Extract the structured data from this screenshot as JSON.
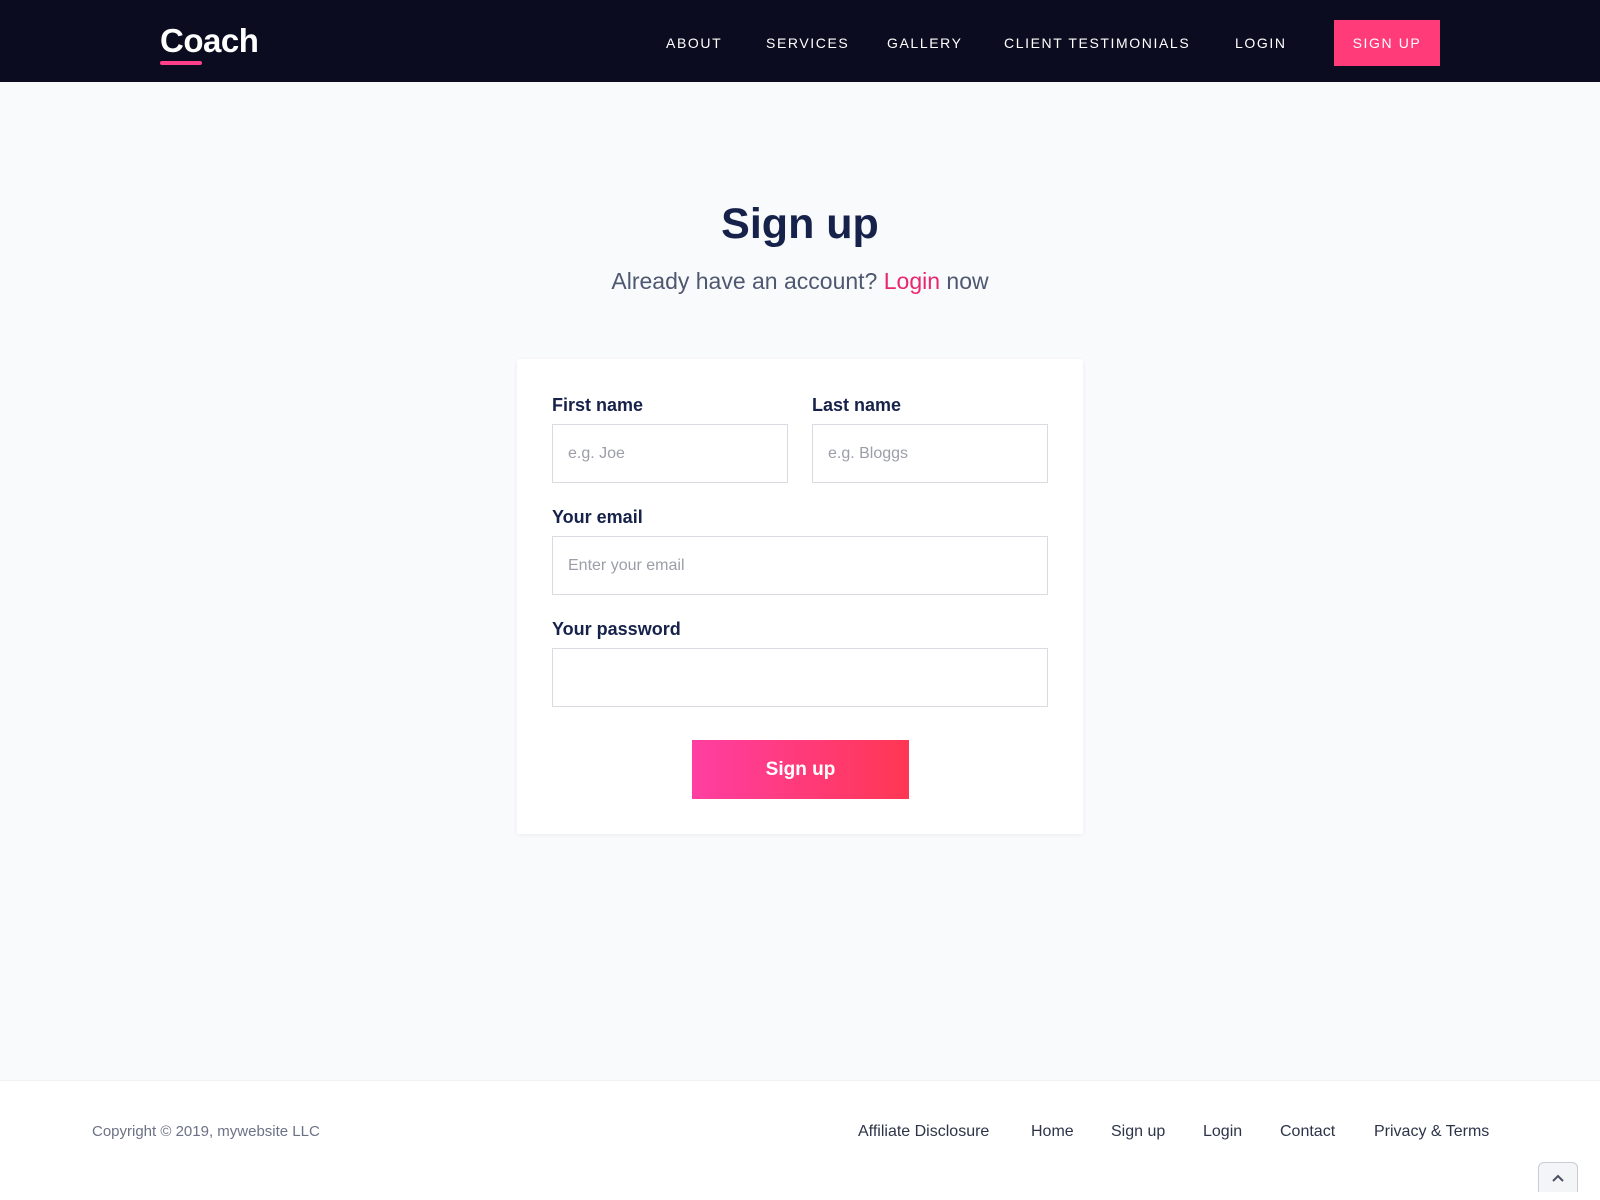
{
  "nav": {
    "logo": "Coach",
    "links": [
      "ABOUT",
      "SERVICES",
      "GALLERY",
      "CLIENT TESTIMONIALS",
      "LOGIN"
    ],
    "signup_label": "SIGN UP"
  },
  "page": {
    "title": "Sign up",
    "subtitle_prefix": "Already have an account?",
    "subtitle_link": "Login",
    "subtitle_suffix": "now"
  },
  "form": {
    "first_name_label": "First name",
    "first_name_placeholder": "e.g. Joe",
    "first_name_value": "",
    "last_name_label": "Last name",
    "last_name_placeholder": "e.g. Bloggs",
    "last_name_value": "",
    "email_label": "Your email",
    "email_placeholder": "Enter your email",
    "email_value": "",
    "password_label": "Your password",
    "password_placeholder": "",
    "password_value": "",
    "submit_label": "Sign up"
  },
  "footer": {
    "copyright": "Copyright © 2019, mywebsite LLC",
    "links": [
      "Affiliate Disclosure",
      "Home",
      "Sign up",
      "Login",
      "Contact",
      "Privacy & Terms"
    ]
  },
  "colors": {
    "nav_bg": "#0b0c1f",
    "accent": "#ff3b79",
    "heading": "#17224a",
    "link": "#e9276d"
  },
  "icons": {
    "scroll_top": "chevron-up-icon"
  }
}
